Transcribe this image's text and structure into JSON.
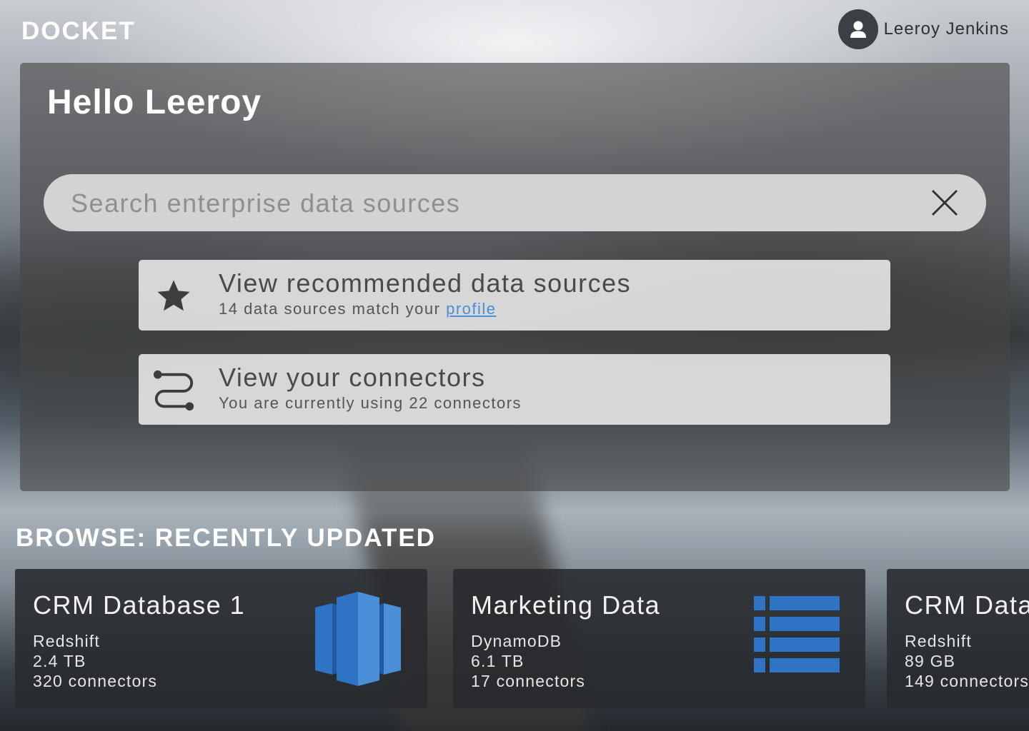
{
  "app": {
    "brand": "DOCKET"
  },
  "user": {
    "name": "Leeroy Jenkins",
    "avatar_icon": "user-icon"
  },
  "hero": {
    "greeting": "Hello Leeroy"
  },
  "search": {
    "placeholder": "Search enterprise data sources",
    "value": "",
    "clear_icon": "close-icon"
  },
  "actions": [
    {
      "icon": "star-icon",
      "title": "View recommended data sources",
      "subtitle_prefix": "14 data sources match your ",
      "link_text": "profile"
    },
    {
      "icon": "route-icon",
      "title": "View your connectors",
      "subtitle": "You are currently using 22 connectors"
    }
  ],
  "browse": {
    "title": "BROWSE: RECENTLY UPDATED",
    "items": [
      {
        "name": "CRM Database 1",
        "type": "Redshift",
        "size": "2.4 TB",
        "connectors": "320 connectors",
        "logo": "redshift-logo"
      },
      {
        "name": "Marketing Data",
        "type": "DynamoDB",
        "size": "6.1 TB",
        "connectors": "17 connectors",
        "logo": "dynamodb-logo"
      },
      {
        "name": "CRM Data",
        "type": "Redshift",
        "size": "89 GB",
        "connectors": "149 connectors",
        "logo": ""
      }
    ]
  },
  "colors": {
    "accent_link": "#4a8ed8",
    "logo_blue": "#2e73c4",
    "panel": "rgba(70,70,70,0.62)"
  }
}
